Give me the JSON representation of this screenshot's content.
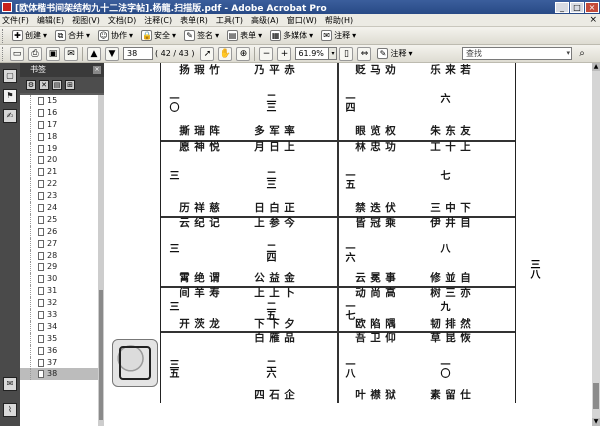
{
  "window": {
    "title": "[欧体楷书间架结构九十二法字帖].杨龍.扫描版.pdf - Adobe Acrobat Pro",
    "minimize": "_",
    "maximize": "□",
    "close": "×"
  },
  "menu": {
    "items": [
      "文件(F)",
      "编辑(E)",
      "视图(V)",
      "文档(D)",
      "注释(C)",
      "表单(R)",
      "工具(T)",
      "高级(A)",
      "窗口(W)",
      "帮助(H)"
    ],
    "close_glyph": "×"
  },
  "toolbar1": {
    "create": "创建",
    "combine": "合并",
    "collaborate": "协作",
    "secure": "安全",
    "sign": "签名",
    "forms": "表单",
    "multimedia": "多媒体",
    "comment": "注释"
  },
  "toolbar2": {
    "page_current": "38",
    "page_label": "( 42 / 43 )",
    "zoom": "61.9%",
    "search_placeholder": "查找"
  },
  "bookmarks": {
    "header": "书签",
    "items": [
      "15",
      "16",
      "17",
      "18",
      "19",
      "20",
      "21",
      "22",
      "23",
      "24",
      "25",
      "26",
      "27",
      "28",
      "29",
      "30",
      "31",
      "32",
      "33",
      "34",
      "35",
      "36",
      "37",
      "38"
    ],
    "selected": "38"
  },
  "document": {
    "page_number": "三八",
    "row_numbers": {
      "col1": [
        "一〇",
        "三",
        "三",
        "三",
        "三五"
      ],
      "col2": [
        "二三",
        "二三",
        "二四",
        "二五",
        "二六"
      ],
      "col3": [
        "一四",
        "一五",
        "一六",
        "一七",
        "一八"
      ],
      "col4": [
        "六",
        "七",
        "八",
        "九",
        "一〇"
      ]
    },
    "cells": [
      {
        "name": "c1r1",
        "cols": [
          "扬撕",
          "瑕瑞",
          "竹阵",
          "乃多",
          "平军",
          "赤率"
        ]
      },
      {
        "name": "c1r2",
        "cols": [
          "愿历",
          "神祥",
          "悦慈",
          "月日",
          "日白",
          "上正"
        ]
      },
      {
        "name": "c1r3",
        "cols": [
          "云霄",
          "纪绝",
          "记谓",
          "上公",
          "参益",
          "今金"
        ]
      },
      {
        "name": "c1r4",
        "cols": [
          "间开",
          "羊茨",
          "寿龙",
          "上下",
          "上下",
          "卜夕"
        ]
      },
      {
        "name": "c1r5",
        "cols": [
          "",
          "",
          "",
          "白四",
          "雁石",
          "品企"
        ]
      },
      {
        "name": "c2r1",
        "cols": [
          "贬眼",
          "马览",
          "劝权",
          "乐朱",
          "来东",
          "若友"
        ]
      },
      {
        "name": "c2r2",
        "cols": [
          "林禁",
          "忠迭",
          "功伏",
          "工三",
          "十中",
          "上下"
        ]
      },
      {
        "name": "c2r3",
        "cols": [
          "皆云",
          "冠冕",
          "乘事",
          "伊修",
          "井並",
          "目自"
        ]
      },
      {
        "name": "c2r4",
        "cols": [
          "动欧",
          "尚陷",
          "高隅",
          "树韧",
          "三排",
          "亦然"
        ]
      },
      {
        "name": "c2r5",
        "cols": [
          "吾叶",
          "卫襟",
          "仰狱",
          "草素",
          "昆留",
          "恢仕"
        ]
      }
    ]
  }
}
